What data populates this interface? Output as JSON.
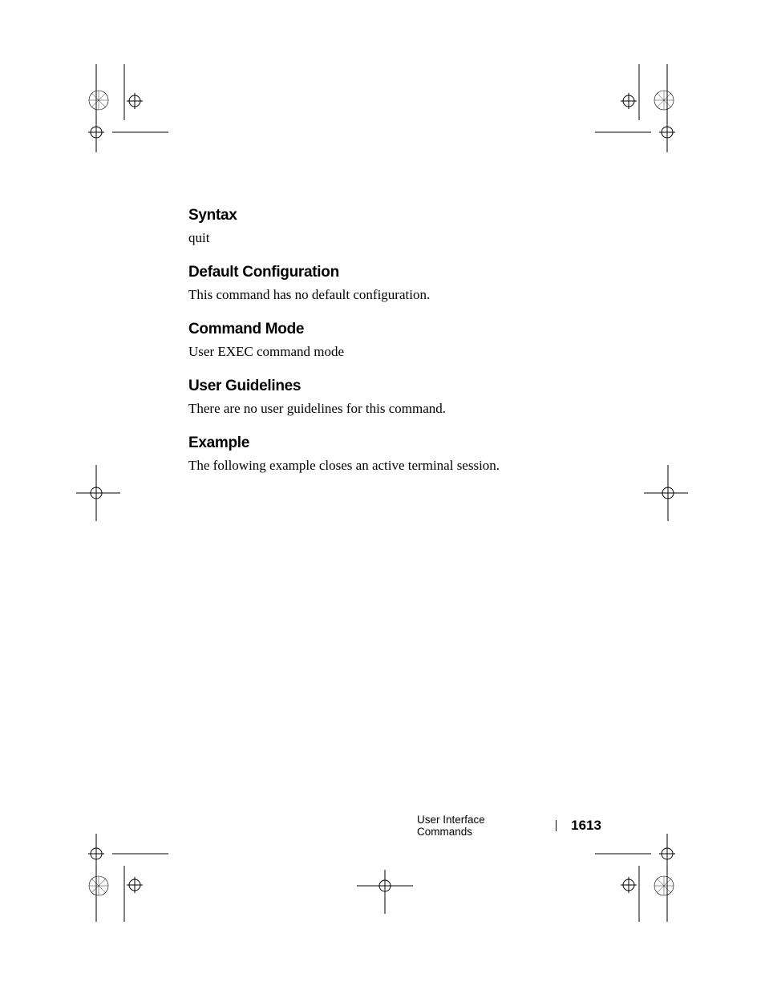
{
  "sections": {
    "syntax": {
      "heading": "Syntax",
      "body": "quit"
    },
    "defaultConfig": {
      "heading": "Default Configuration",
      "body": "This command has no default configuration."
    },
    "commandMode": {
      "heading": "Command Mode",
      "body": "User EXEC command mode"
    },
    "userGuidelines": {
      "heading": "User Guidelines",
      "body": "There are no user guidelines for this command."
    },
    "example": {
      "heading": "Example",
      "body": "The following example closes an active terminal session."
    }
  },
  "footer": {
    "title": "User Interface Commands",
    "page": "1613"
  }
}
